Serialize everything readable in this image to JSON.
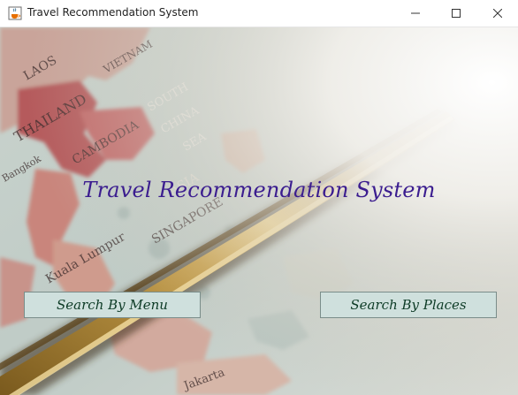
{
  "window": {
    "title": "Travel Recommendation System",
    "app_icon": "java-coffee-cup-icon",
    "controls": {
      "minimize_icon": "minimize-icon",
      "maximize_icon": "maximize-icon",
      "close_icon": "close-icon"
    }
  },
  "main": {
    "heading": "Travel Recommendation System",
    "background_image": "vintage-globe-map-southeast-asia",
    "map_labels": [
      "LAOS",
      "VIETNAM",
      "THAILAND",
      "SOUTH",
      "CHINA",
      "SEA",
      "CAMBODIA",
      "ASIA",
      "Bangkok",
      "SINGAPORE",
      "Kuala Lumpur",
      "Jakarta"
    ],
    "buttons": {
      "search_by_menu": "Search By Menu",
      "search_by_places": "Search By Places"
    }
  },
  "colors": {
    "heading": "#3b1d8f",
    "button_bg": "#cfe0dd",
    "button_text": "#0d3b26",
    "button_border": "#7a8d8a"
  }
}
